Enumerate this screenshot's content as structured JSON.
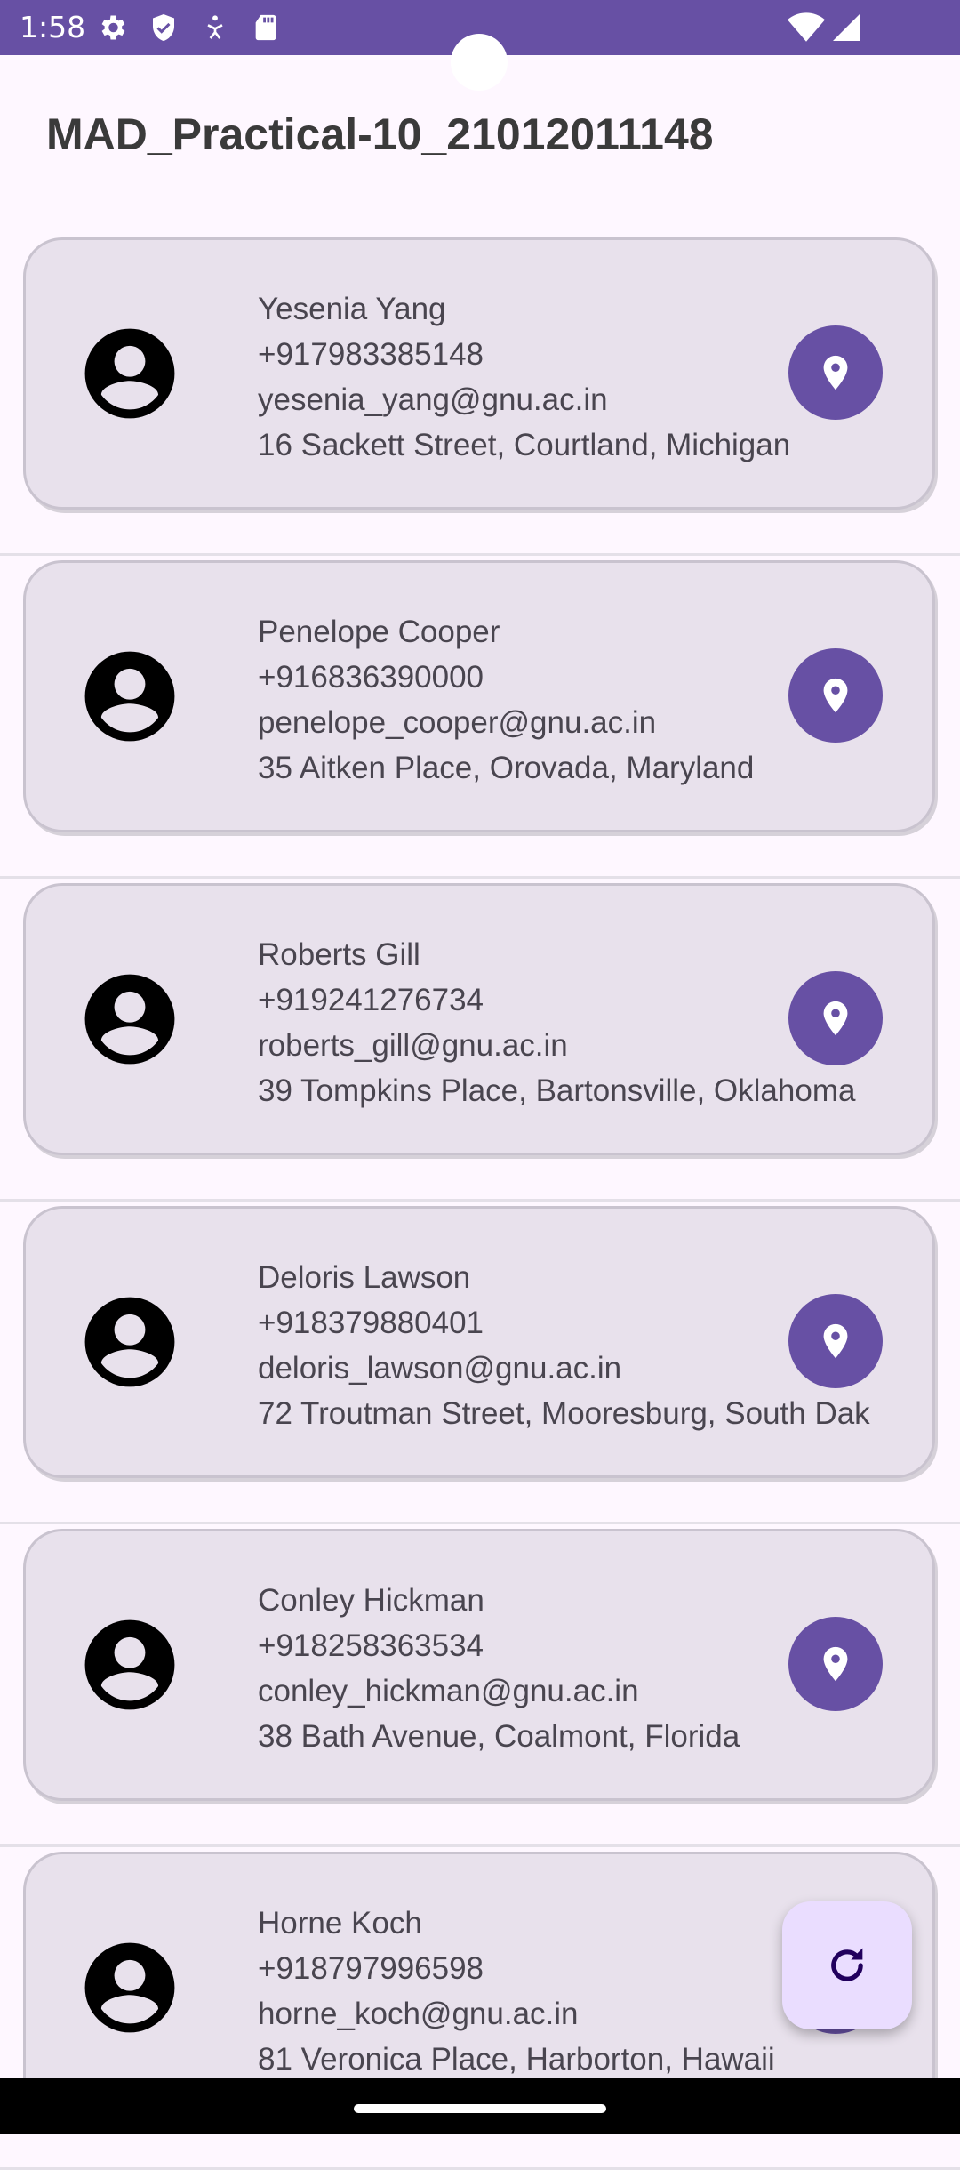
{
  "status_bar": {
    "time": "1:58",
    "icons": [
      "settings-icon",
      "shield-icon",
      "accessibility-icon",
      "sd-card-icon",
      "wifi-icon",
      "signal-icon"
    ]
  },
  "app_bar": {
    "title": "MAD_Practical-10_21012011148"
  },
  "colors": {
    "primary": "#6750a4",
    "card_background": "#e8e1ec",
    "fab_background": "#eaddff",
    "background": "#fef7ff"
  },
  "contacts": [
    {
      "name": "Yesenia Yang",
      "phone": "+917983385148",
      "email": "yesenia_yang@gnu.ac.in",
      "address": "16 Sackett Street, Courtland, Michigan"
    },
    {
      "name": "Penelope Cooper",
      "phone": "+916836390000",
      "email": "penelope_cooper@gnu.ac.in",
      "address": "35 Aitken Place, Orovada, Maryland"
    },
    {
      "name": "Roberts Gill",
      "phone": "+919241276734",
      "email": "roberts_gill@gnu.ac.in",
      "address": "39 Tompkins Place, Bartonsville, Oklahoma"
    },
    {
      "name": "Deloris Lawson",
      "phone": "+918379880401",
      "email": "deloris_lawson@gnu.ac.in",
      "address": "72 Troutman Street, Mooresburg, South Dak"
    },
    {
      "name": "Conley Hickman",
      "phone": "+918258363534",
      "email": "conley_hickman@gnu.ac.in",
      "address": "38 Bath Avenue, Coalmont, Florida"
    },
    {
      "name": "Horne Koch",
      "phone": "+918797996598",
      "email": "horne_koch@gnu.ac.in",
      "address": "81 Veronica Place, Harborton, Hawaii"
    }
  ],
  "fab": {
    "icon": "refresh-icon"
  }
}
